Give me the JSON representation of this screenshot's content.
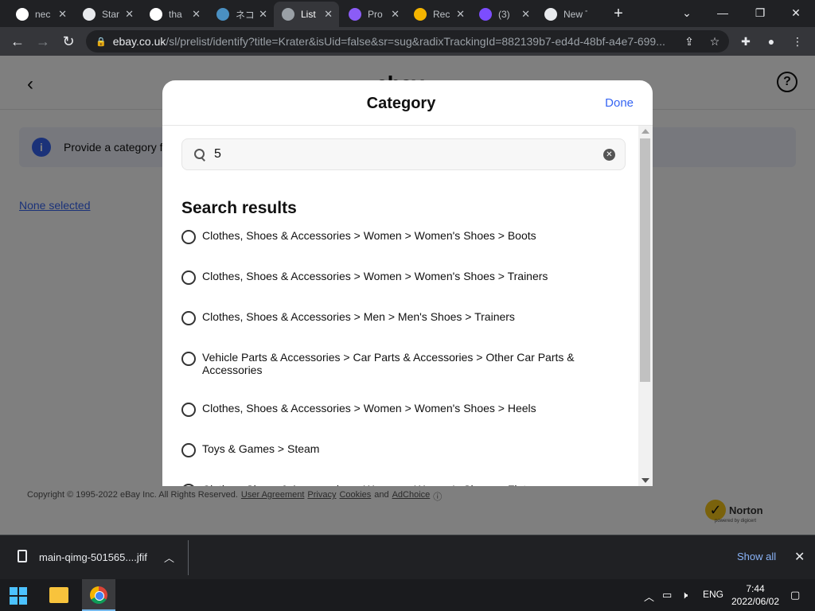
{
  "browser": {
    "tabs": [
      {
        "title": "nec",
        "favicon": "google-icon",
        "favicon_color": "#ffffff"
      },
      {
        "title": "Star",
        "favicon": "document-icon",
        "favicon_color": "#e8eaed"
      },
      {
        "title": "tha",
        "favicon": "google-icon",
        "favicon_color": "#ffffff"
      },
      {
        "title": "ネコ",
        "favicon": "p-icon",
        "favicon_color": "#4a90c2"
      },
      {
        "title": "List",
        "favicon": "globe-icon",
        "favicon_color": "#9aa0a6"
      },
      {
        "title": "Pro",
        "favicon": "p-icon",
        "favicon_color": "#8b5cf6"
      },
      {
        "title": "Rec",
        "favicon": "colorful-icon",
        "favicon_color": "#f4b400"
      },
      {
        "title": "(3)",
        "favicon": "mail-icon",
        "favicon_color": "#7c4dff"
      },
      {
        "title": "New Tab",
        "favicon": "chrome-icon",
        "favicon_color": "#e8eaed"
      }
    ],
    "url_host": "ebay.co.uk",
    "url_path": "/sl/prelist/identify?title=Krater&isUid=false&sr=sug&radixTrackingId=882139b7-ed4d-48bf-a4e7-699..."
  },
  "page": {
    "logo": "ebay",
    "info_text": "Provide a category f",
    "none_selected": "None selected",
    "footer": {
      "copyright": "Copyright © 1995-2022 eBay Inc. All Rights Reserved.",
      "links": [
        "User Agreement",
        "Privacy",
        "Cookies"
      ],
      "and": "and",
      "adchoice": "AdChoice"
    },
    "norton": {
      "name": "Norton",
      "sub": "powered by digicert"
    }
  },
  "modal": {
    "title": "Category",
    "done": "Done",
    "search_value": "5",
    "results_title": "Search results",
    "results": [
      "Clothes, Shoes & Accessories > Women > Women's Shoes > Boots",
      "Clothes, Shoes & Accessories > Women > Women's Shoes > Trainers",
      "Clothes, Shoes & Accessories > Men > Men's Shoes > Trainers",
      "Vehicle Parts & Accessories > Car Parts & Accessories > Other Car Parts & Accessories",
      "Clothes, Shoes & Accessories > Women > Women's Shoes > Heels",
      "Toys & Games > Steam",
      "Clothes, Shoes & Accessories > Women > Women's Shoes > Flats"
    ]
  },
  "download_bar": {
    "file": "main-qimg-501565....jfif",
    "show_all": "Show all"
  },
  "taskbar": {
    "lang": "ENG",
    "time": "7:44",
    "date": "2022/06/02"
  }
}
